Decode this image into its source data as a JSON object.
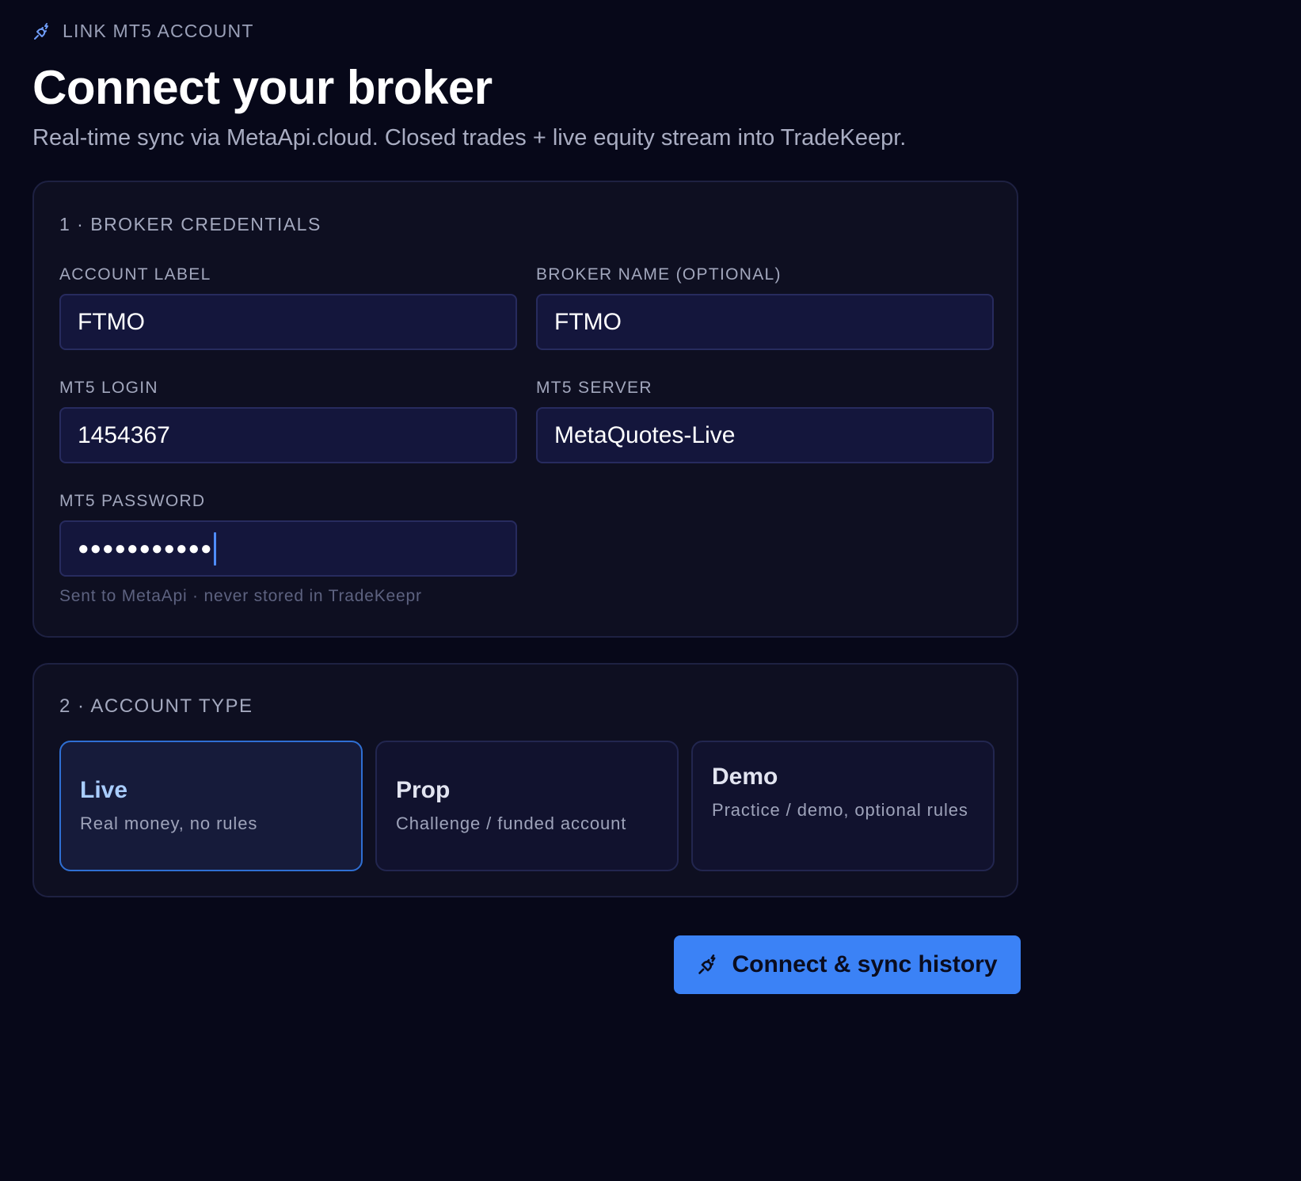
{
  "header": {
    "eyebrow": "LINK MT5 ACCOUNT",
    "eyebrow_icon": "plug-icon",
    "title": "Connect your broker",
    "subtitle": "Real-time sync via MetaApi.cloud. Closed trades + live equity stream into TradeKeepr."
  },
  "credentials": {
    "section_label": "1 · BROKER CREDENTIALS",
    "account_label": {
      "label": "ACCOUNT LABEL",
      "value": "FTMO"
    },
    "broker_name": {
      "label": "BROKER NAME (OPTIONAL)",
      "value": "FTMO"
    },
    "mt5_login": {
      "label": "MT5 LOGIN",
      "value": "1454367"
    },
    "mt5_server": {
      "label": "MT5 SERVER",
      "value": "MetaQuotes-Live"
    },
    "mt5_password": {
      "label": "MT5 PASSWORD",
      "value": "●●●●●●●●●●●"
    },
    "hint": "Sent to MetaApi · never stored in TradeKeepr"
  },
  "account_type": {
    "section_label": "2 · ACCOUNT TYPE",
    "selected": "Live",
    "options": [
      {
        "name": "Live",
        "description": "Real money, no rules"
      },
      {
        "name": "Prop",
        "description": "Challenge / funded account"
      },
      {
        "name": "Demo",
        "description": "Practice / demo, optional rules"
      }
    ]
  },
  "actions": {
    "submit_label": "Connect & sync history",
    "submit_icon": "plug-icon"
  },
  "colors": {
    "background": "#070819",
    "card": "#0e0f21",
    "input": "#14163c",
    "accent": "#3b82f6",
    "selected_border": "#2f6fd3"
  }
}
